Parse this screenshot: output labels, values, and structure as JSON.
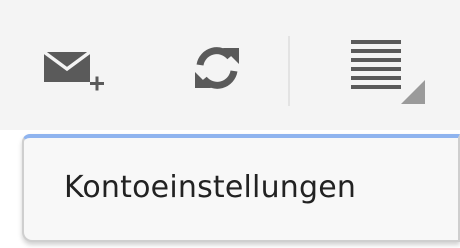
{
  "action_bar": {
    "icons": [
      "compose-mail-icon",
      "refresh-icon",
      "menu-lines-icon"
    ],
    "icon_color": "#5a5a5a",
    "background": "#f4f4f4"
  },
  "overflow_menu": {
    "accent_color": "#8fb4ef",
    "items": [
      {
        "label": "Kontoeinstellungen"
      }
    ]
  }
}
